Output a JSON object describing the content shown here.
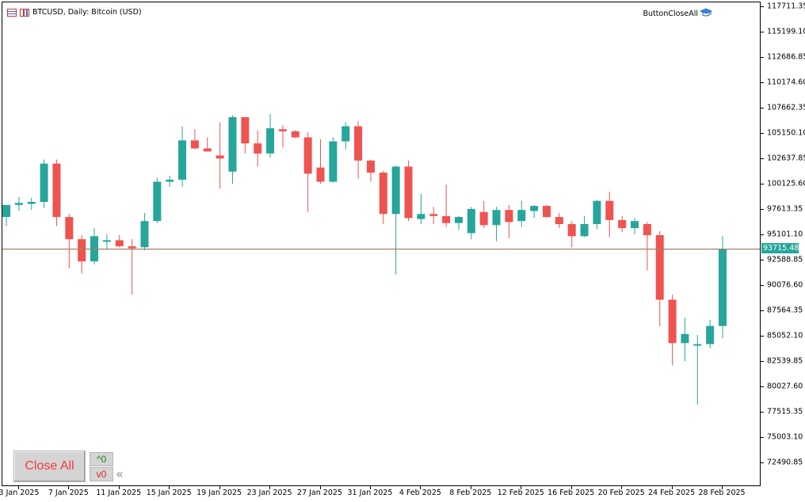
{
  "chart": {
    "symbol_title": "BTCUSD, Daily:  Bitcoin (USD)",
    "expert_name": "ButtonCloseAll",
    "current_price": "93715.48",
    "icons": {
      "menu": "chart-list-icon",
      "period": "period-bars-icon",
      "expert": "graduation-cap-icon"
    },
    "colors": {
      "bull": "#26a69a",
      "bear": "#ef5350",
      "price_line": "#a97a6a",
      "buy_arrow": "#1f5fb3",
      "sell_arrow": "#e2452b"
    }
  },
  "price_axis": {
    "labels": [
      "117711.35",
      "115199.10",
      "112686.85",
      "110174.60",
      "107662.35",
      "105150.10",
      "102637.85",
      "100125.60",
      "97613.35",
      "95101.10",
      "92588.85",
      "90076.60",
      "87564.35",
      "85052.10",
      "82539.85",
      "80027.60",
      "77515.35",
      "75003.10",
      "72490.85"
    ]
  },
  "time_axis": {
    "labels": [
      "3 Jan 2025",
      "7 Jan 2025",
      "11 Jan 2025",
      "15 Jan 2025",
      "19 Jan 2025",
      "23 Jan 2025",
      "27 Jan 2025",
      "31 Jan 2025",
      "4 Feb 2025",
      "8 Feb 2025",
      "12 Feb 2025",
      "16 Feb 2025",
      "20 Feb 2025",
      "24 Feb 2025",
      "28 Feb 2025"
    ]
  },
  "panel": {
    "close_all_label": "Close All",
    "buy_count_label": "^0",
    "sell_count_label": "v0",
    "collapse_icon": "double-chevron-left-icon"
  },
  "chart_data": {
    "type": "candlestick",
    "x_start_date": "2025-01-02",
    "price_range": [
      71500,
      118200
    ],
    "last_price": 93715.48,
    "candles": [
      {
        "o": 96900,
        "h": 98000,
        "l": 96000,
        "c": 98100
      },
      {
        "o": 98100,
        "h": 98900,
        "l": 97500,
        "c": 98300
      },
      {
        "o": 98200,
        "h": 98800,
        "l": 97600,
        "c": 98400
      },
      {
        "o": 98400,
        "h": 102600,
        "l": 97800,
        "c": 102200
      },
      {
        "o": 102200,
        "h": 102600,
        "l": 96000,
        "c": 96900
      },
      {
        "o": 96900,
        "h": 97200,
        "l": 91800,
        "c": 94700
      },
      {
        "o": 94700,
        "h": 95100,
        "l": 91300,
        "c": 92500
      },
      {
        "o": 92500,
        "h": 95800,
        "l": 92200,
        "c": 95000
      },
      {
        "o": 94600,
        "h": 95200,
        "l": 93700,
        "c": 94600
      },
      {
        "o": 94600,
        "h": 95100,
        "l": 93900,
        "c": 94000
      },
      {
        "o": 94000,
        "h": 94700,
        "l": 89200,
        "c": 93800
      },
      {
        "o": 93900,
        "h": 97300,
        "l": 93600,
        "c": 96500
      },
      {
        "o": 96500,
        "h": 100800,
        "l": 96300,
        "c": 100400
      },
      {
        "o": 100400,
        "h": 101000,
        "l": 99900,
        "c": 100600
      },
      {
        "o": 100600,
        "h": 105900,
        "l": 99900,
        "c": 104500
      },
      {
        "o": 104500,
        "h": 105600,
        "l": 103600,
        "c": 103700
      },
      {
        "o": 103700,
        "h": 104800,
        "l": 103400,
        "c": 103400
      },
      {
        "o": 103000,
        "h": 106300,
        "l": 99700,
        "c": 102700
      },
      {
        "o": 101400,
        "h": 107000,
        "l": 100200,
        "c": 106800
      },
      {
        "o": 106800,
        "h": 106800,
        "l": 103200,
        "c": 104200
      },
      {
        "o": 104200,
        "h": 105500,
        "l": 101900,
        "c": 103200
      },
      {
        "o": 103200,
        "h": 107100,
        "l": 102800,
        "c": 105700
      },
      {
        "o": 105600,
        "h": 106000,
        "l": 103800,
        "c": 105400
      },
      {
        "o": 105400,
        "h": 105500,
        "l": 104700,
        "c": 104800
      },
      {
        "o": 104800,
        "h": 105300,
        "l": 97400,
        "c": 101200
      },
      {
        "o": 101800,
        "h": 104600,
        "l": 100200,
        "c": 100400
      },
      {
        "o": 100400,
        "h": 104800,
        "l": 100300,
        "c": 104400
      },
      {
        "o": 104400,
        "h": 106300,
        "l": 103600,
        "c": 105900
      },
      {
        "o": 105900,
        "h": 106400,
        "l": 100700,
        "c": 102500
      },
      {
        "o": 102500,
        "h": 102600,
        "l": 100400,
        "c": 101300
      },
      {
        "o": 101300,
        "h": 101500,
        "l": 96200,
        "c": 97200
      },
      {
        "o": 97200,
        "h": 102000,
        "l": 91200,
        "c": 101900
      },
      {
        "o": 101900,
        "h": 102500,
        "l": 96500,
        "c": 96800
      },
      {
        "o": 96700,
        "h": 99200,
        "l": 96200,
        "c": 97200
      },
      {
        "o": 97200,
        "h": 97900,
        "l": 96200,
        "c": 97000
      },
      {
        "o": 97000,
        "h": 100100,
        "l": 95900,
        "c": 96300
      },
      {
        "o": 96300,
        "h": 97000,
        "l": 95600,
        "c": 96900
      },
      {
        "o": 95300,
        "h": 97900,
        "l": 94700,
        "c": 97700
      },
      {
        "o": 97400,
        "h": 98500,
        "l": 95800,
        "c": 96100
      },
      {
        "o": 96100,
        "h": 97900,
        "l": 94500,
        "c": 97600
      },
      {
        "o": 97600,
        "h": 98100,
        "l": 94800,
        "c": 96400
      },
      {
        "o": 96500,
        "h": 98500,
        "l": 95900,
        "c": 97600
      },
      {
        "o": 97500,
        "h": 98100,
        "l": 96800,
        "c": 98000
      },
      {
        "o": 98000,
        "h": 98100,
        "l": 96800,
        "c": 96900
      },
      {
        "o": 96900,
        "h": 97300,
        "l": 95800,
        "c": 96200
      },
      {
        "o": 96200,
        "h": 96500,
        "l": 93900,
        "c": 95000
      },
      {
        "o": 95000,
        "h": 97000,
        "l": 94900,
        "c": 96200
      },
      {
        "o": 96200,
        "h": 98600,
        "l": 95700,
        "c": 98500
      },
      {
        "o": 98500,
        "h": 99400,
        "l": 94900,
        "c": 96600
      },
      {
        "o": 96600,
        "h": 97000,
        "l": 95400,
        "c": 95800
      },
      {
        "o": 95800,
        "h": 96800,
        "l": 95200,
        "c": 96500
      },
      {
        "o": 96200,
        "h": 96400,
        "l": 91600,
        "c": 95100
      },
      {
        "o": 95100,
        "h": 95500,
        "l": 86100,
        "c": 88700
      },
      {
        "o": 88700,
        "h": 89200,
        "l": 82200,
        "c": 84400
      },
      {
        "o": 84400,
        "h": 86900,
        "l": 82600,
        "c": 85300
      },
      {
        "o": 84300,
        "h": 85200,
        "l": 78300,
        "c": 84300
      },
      {
        "o": 84300,
        "h": 86700,
        "l": 83900,
        "c": 86100
      },
      {
        "o": 86100,
        "h": 95000,
        "l": 84900,
        "c": 93715
      }
    ]
  }
}
